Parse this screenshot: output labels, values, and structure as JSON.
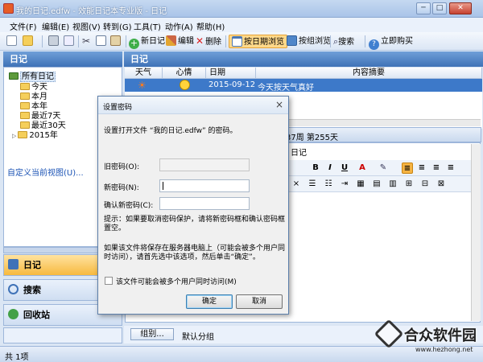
{
  "window": {
    "title": "我的日记.edfw - 效能日记本专业版 - 日记",
    "min": "─",
    "max": "□",
    "close": "✕"
  },
  "menu": [
    "文件(F)",
    "编辑(E)",
    "视图(V)",
    "转到(G)",
    "工具(T)",
    "动作(A)",
    "帮助(H)"
  ],
  "toolbar": {
    "new_diary": "新日记",
    "edit": "编辑",
    "delete": "删除",
    "browse_by_date": "按日期浏览",
    "browse_by_group": "按组浏览",
    "search": "搜索",
    "buy_now": "立即购买"
  },
  "left": {
    "header": "日记",
    "tree": [
      {
        "label": "所有日记"
      },
      {
        "label": "今天"
      },
      {
        "label": "本月"
      },
      {
        "label": "本年"
      },
      {
        "label": "最近7天"
      },
      {
        "label": "最近30天"
      },
      {
        "label": "2015年"
      }
    ],
    "custom_view": "自定义当前视图(U)...",
    "nav": {
      "diary": "日记",
      "search": "搜索",
      "recycle": "回收站"
    }
  },
  "right": {
    "header": "日记",
    "columns": {
      "weather": "天气",
      "mood": "心情",
      "date": "日期",
      "summary": "内容摘要"
    },
    "row": {
      "date": "2015-09-12",
      "summary": "今天按天气真好"
    },
    "info": "37周 第255天",
    "title_text": "日记",
    "group_button": "组别...",
    "group_value": "默认分组"
  },
  "status": {
    "count": "共 1项"
  },
  "dialog": {
    "title": "设置密码",
    "close": "×",
    "prompt": "设置打开文件 “我的日记.edfw” 的密码。",
    "old_password_label": "旧密码(O):",
    "new_password_label": "新密码(N):",
    "confirm_password_label": "确认新密码(C):",
    "tip": "提示：如果要取消密码保护，请将新密码框和确认密码框置空。",
    "server_note": "如果该文件将保存在服务器电脑上（可能会被多个用户同时访问），请首先选中该选项，然后单击“确定”。",
    "checkbox_label": "该文件可能会被多个用户同时访问(M)",
    "ok": "确定",
    "cancel": "取消"
  },
  "watermark": {
    "name": "合众软件园",
    "url": "www.hezhong.net"
  }
}
